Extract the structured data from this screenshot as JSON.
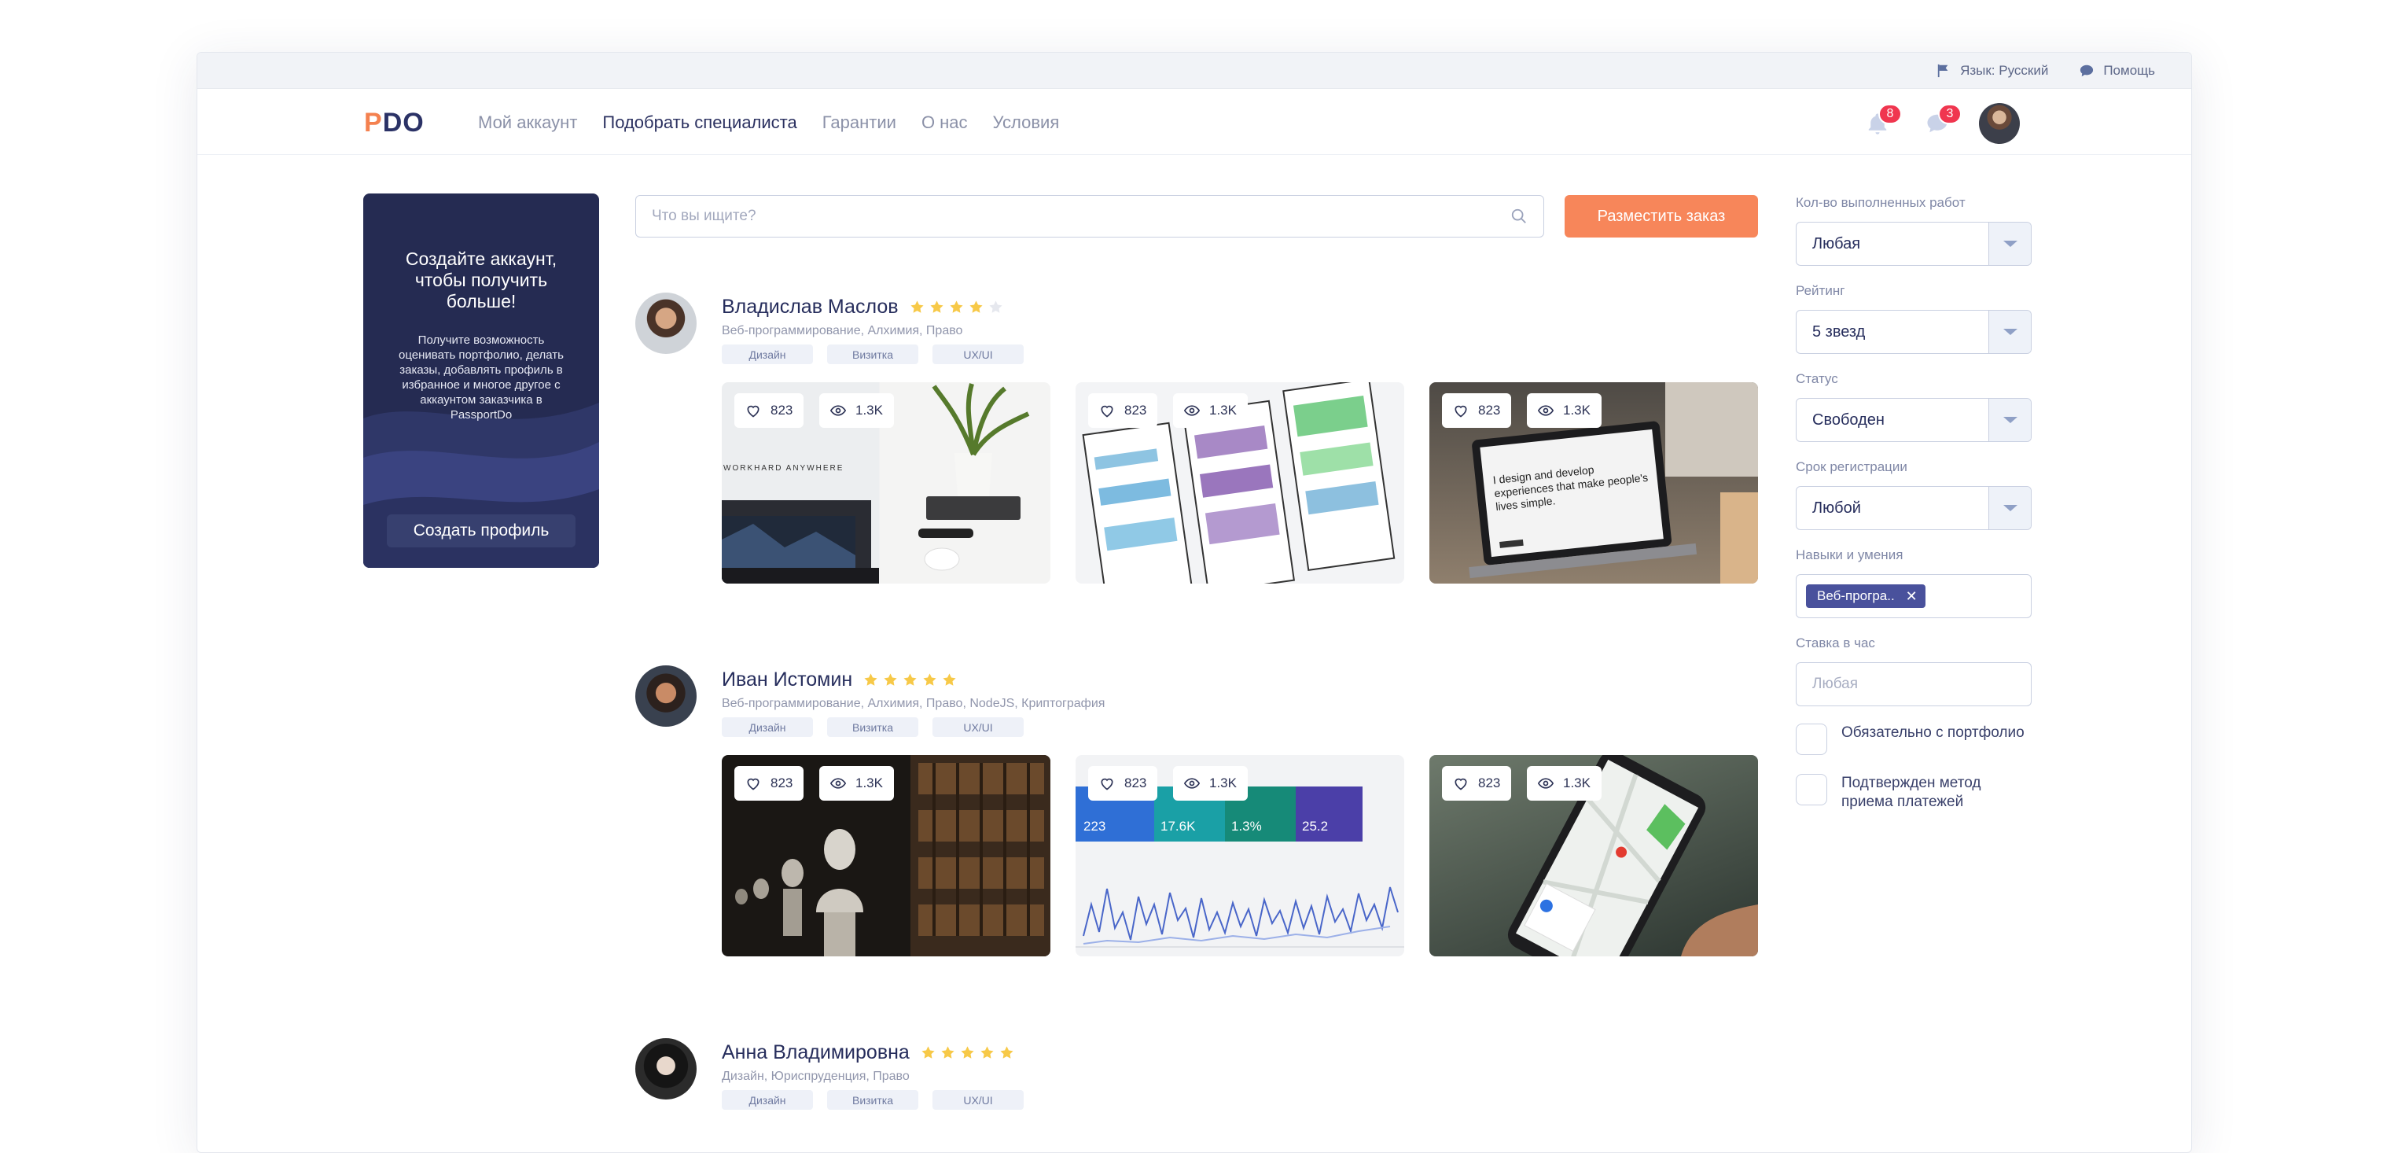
{
  "topbar": {
    "language": "Язык: Русский",
    "help": "Помощь"
  },
  "nav": {
    "logo_first": "P",
    "logo_rest": "DO",
    "menu": [
      "Мой аккаунт",
      "Подобрать специалиста",
      "Гарантии",
      "О нас",
      "Условия"
    ],
    "notifications_count": "8",
    "messages_count": "3"
  },
  "promo": {
    "title": "Создайте аккаунт, чтобы получить больше!",
    "text": "Получите возможность оценивать портфолио, делать заказы, добавлять профиль в избранное  и многое другое с аккаунтом заказчика в PassportDo",
    "button": "Создать профиль"
  },
  "search": {
    "placeholder": "Что вы ищите?",
    "order_button": "Разместить заказ"
  },
  "specialists": [
    {
      "name": "Владислав Маслов",
      "rating": 4,
      "skills": "Веб-программирование, Алхимия, Право",
      "tags": [
        "Дизайн",
        "Визитка",
        "UX/UI"
      ],
      "works": [
        {
          "likes": "823",
          "views": "1.3K",
          "image_text": "WORKHARD ANYWHERE"
        },
        {
          "likes": "823",
          "views": "1.3K"
        },
        {
          "likes": "823",
          "views": "1.3K",
          "image_text": "I design and develop experiences that make people's lives simple."
        }
      ]
    },
    {
      "name": "Иван Истомин",
      "rating": 5,
      "skills": "Веб-программирование, Алхимия, Право, NodeJS, Криптография",
      "tags": [
        "Дизайн",
        "Визитка",
        "UX/UI"
      ],
      "works": [
        {
          "likes": "823",
          "views": "1.3K"
        },
        {
          "likes": "823",
          "views": "1.3K",
          "dashboard": [
            "223",
            "17.6K",
            "1.3%",
            "25.2"
          ]
        },
        {
          "likes": "823",
          "views": "1.3K"
        }
      ]
    },
    {
      "name": "Анна Владимировна",
      "rating": 5,
      "skills": "Дизайн, Юриспруденция, Право",
      "tags": [
        "Дизайн",
        "Визитка",
        "UX/UI"
      ]
    }
  ],
  "filters": {
    "works_count": {
      "label": "Кол-во выполненных работ",
      "value": "Любая"
    },
    "rating": {
      "label": "Рейтинг",
      "value": "5 звезд"
    },
    "status": {
      "label": "Статус",
      "value": "Свободен"
    },
    "registration": {
      "label": "Срок регистрации",
      "value": "Любой"
    },
    "skills": {
      "label": "Навыки и умения",
      "chip": "Веб-програ.."
    },
    "rate": {
      "label": "Ставка в час",
      "placeholder": "Любая"
    },
    "portfolio_required": "Обязательно с портфолио",
    "payment_confirmed": "Подтвержден метод приема платежей"
  },
  "colors": {
    "accent": "#f7865a",
    "navy": "#252b52",
    "star": "#f7c948",
    "badge": "#f0364f"
  }
}
